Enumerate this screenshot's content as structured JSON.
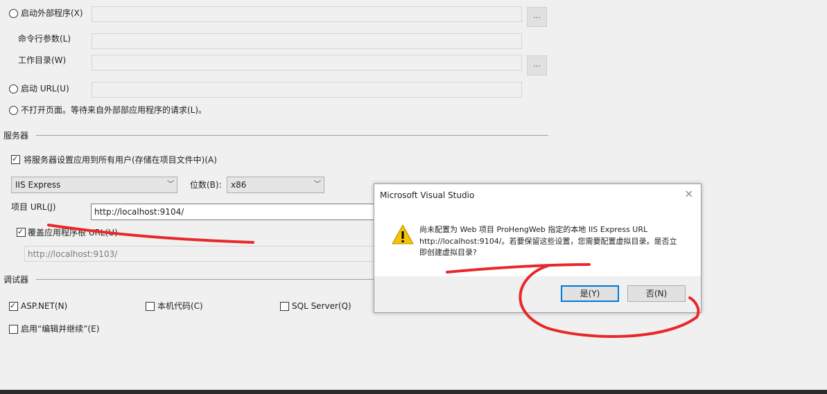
{
  "launch": {
    "external_program_label": "启动外部程序(X)",
    "external_program_value": "",
    "cmd_args_label": "命令行参数(L)",
    "cmd_args_value": "",
    "work_dir_label": "工作目录(W)",
    "work_dir_value": "",
    "browse_label": "...",
    "start_url_label": "启动 URL(U)",
    "start_url_value": "",
    "no_open_label": "不打开页面。等待来自外部部应用程序的请求(L)。"
  },
  "server": {
    "section_title": "服务器",
    "apply_all_label": "将服务器设置应用到所有用户(存储在项目文件中)(A)",
    "apply_all_checked": true,
    "server_type": "IIS Express",
    "bitness_label": "位数(B):",
    "bitness": "x86",
    "project_url_label": "项目 URL(J)",
    "project_url_value": "http://localhost:9104/",
    "override_label": "覆盖应用程序根 URL(U)",
    "override_checked": true,
    "override_value": "http://localhost:9103/"
  },
  "debugger": {
    "section_title": "调试器",
    "aspnet_label": "ASP.NET(N)",
    "aspnet_checked": true,
    "native_label": "本机代码(C)",
    "native_checked": false,
    "sql_label": "SQL Server(Q)",
    "sql_checked": false,
    "edit_continue_label": "启用“编辑并继续”(E)",
    "edit_continue_checked": false
  },
  "dialog": {
    "title": "Microsoft Visual Studio",
    "icon": "warning-icon",
    "message_line1": "尚未配置为 Web 项目 ProHengWeb 指定的本地 IIS Express URL",
    "message_line2": "http://localhost:9104/。若要保留这些设置，您需要配置虚拟目录。是否立",
    "message_line3": "即创建虚拟目录?",
    "yes_label": "是(Y)",
    "no_label": "否(N)",
    "close_label": "×"
  },
  "colors": {
    "background": "#f0f0f0",
    "annotation_red": "#e8282b",
    "default_button_border": "#0078d7",
    "warning_yellow": "#f5c400"
  }
}
